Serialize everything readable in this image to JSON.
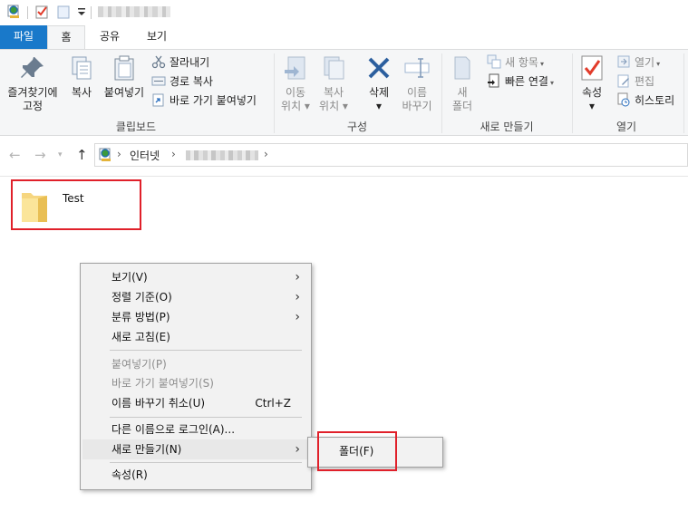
{
  "tabs": {
    "file": "파일",
    "home": "홈",
    "share": "공유",
    "view": "보기"
  },
  "ribbon": {
    "clipboard": {
      "label": "클립보드",
      "pin": "즐겨찾기에\n고정",
      "copy": "복사",
      "paste": "붙여넣기",
      "cut": "잘라내기",
      "copy_path": "경로 복사",
      "paste_shortcut": "바로 가기 붙여넣기"
    },
    "organize": {
      "label": "구성",
      "move_to": "이동\n위치 ▾",
      "copy_to": "복사\n위치 ▾",
      "delete": "삭제\n▾",
      "rename": "이름\n바꾸기"
    },
    "new": {
      "label": "새로 만들기",
      "new_folder": "새\n폴더",
      "new_item": "새 항목",
      "easy_access": "빠른 연결"
    },
    "open": {
      "label": "열기",
      "properties": "속성\n▾",
      "open": "열기",
      "edit": "편집",
      "history": "히스토리"
    }
  },
  "address": {
    "root": "인터넷"
  },
  "content": {
    "folder_name": "Test"
  },
  "context_menu": {
    "items": [
      {
        "label": "보기(V)"
      },
      {
        "label": "정렬 기준(O)"
      },
      {
        "label": "분류 방법(P)"
      },
      {
        "label": "새로 고침(E)"
      },
      {
        "label": "붙여넣기(P)"
      },
      {
        "label": "바로 가기 붙여넣기(S)"
      },
      {
        "label": "이름 바꾸기 취소(U)",
        "shortcut": "Ctrl+Z"
      },
      {
        "label": "다른 이름으로 로그인(A)..."
      },
      {
        "label": "새로 만들기(N)"
      },
      {
        "label": "속성(R)"
      }
    ],
    "submenu": {
      "folder": "폴더(F)"
    }
  },
  "colors": {
    "file_tab": "#1979ca",
    "highlight_box": "#e0202a",
    "menu_bg": "#f2f2f2"
  }
}
